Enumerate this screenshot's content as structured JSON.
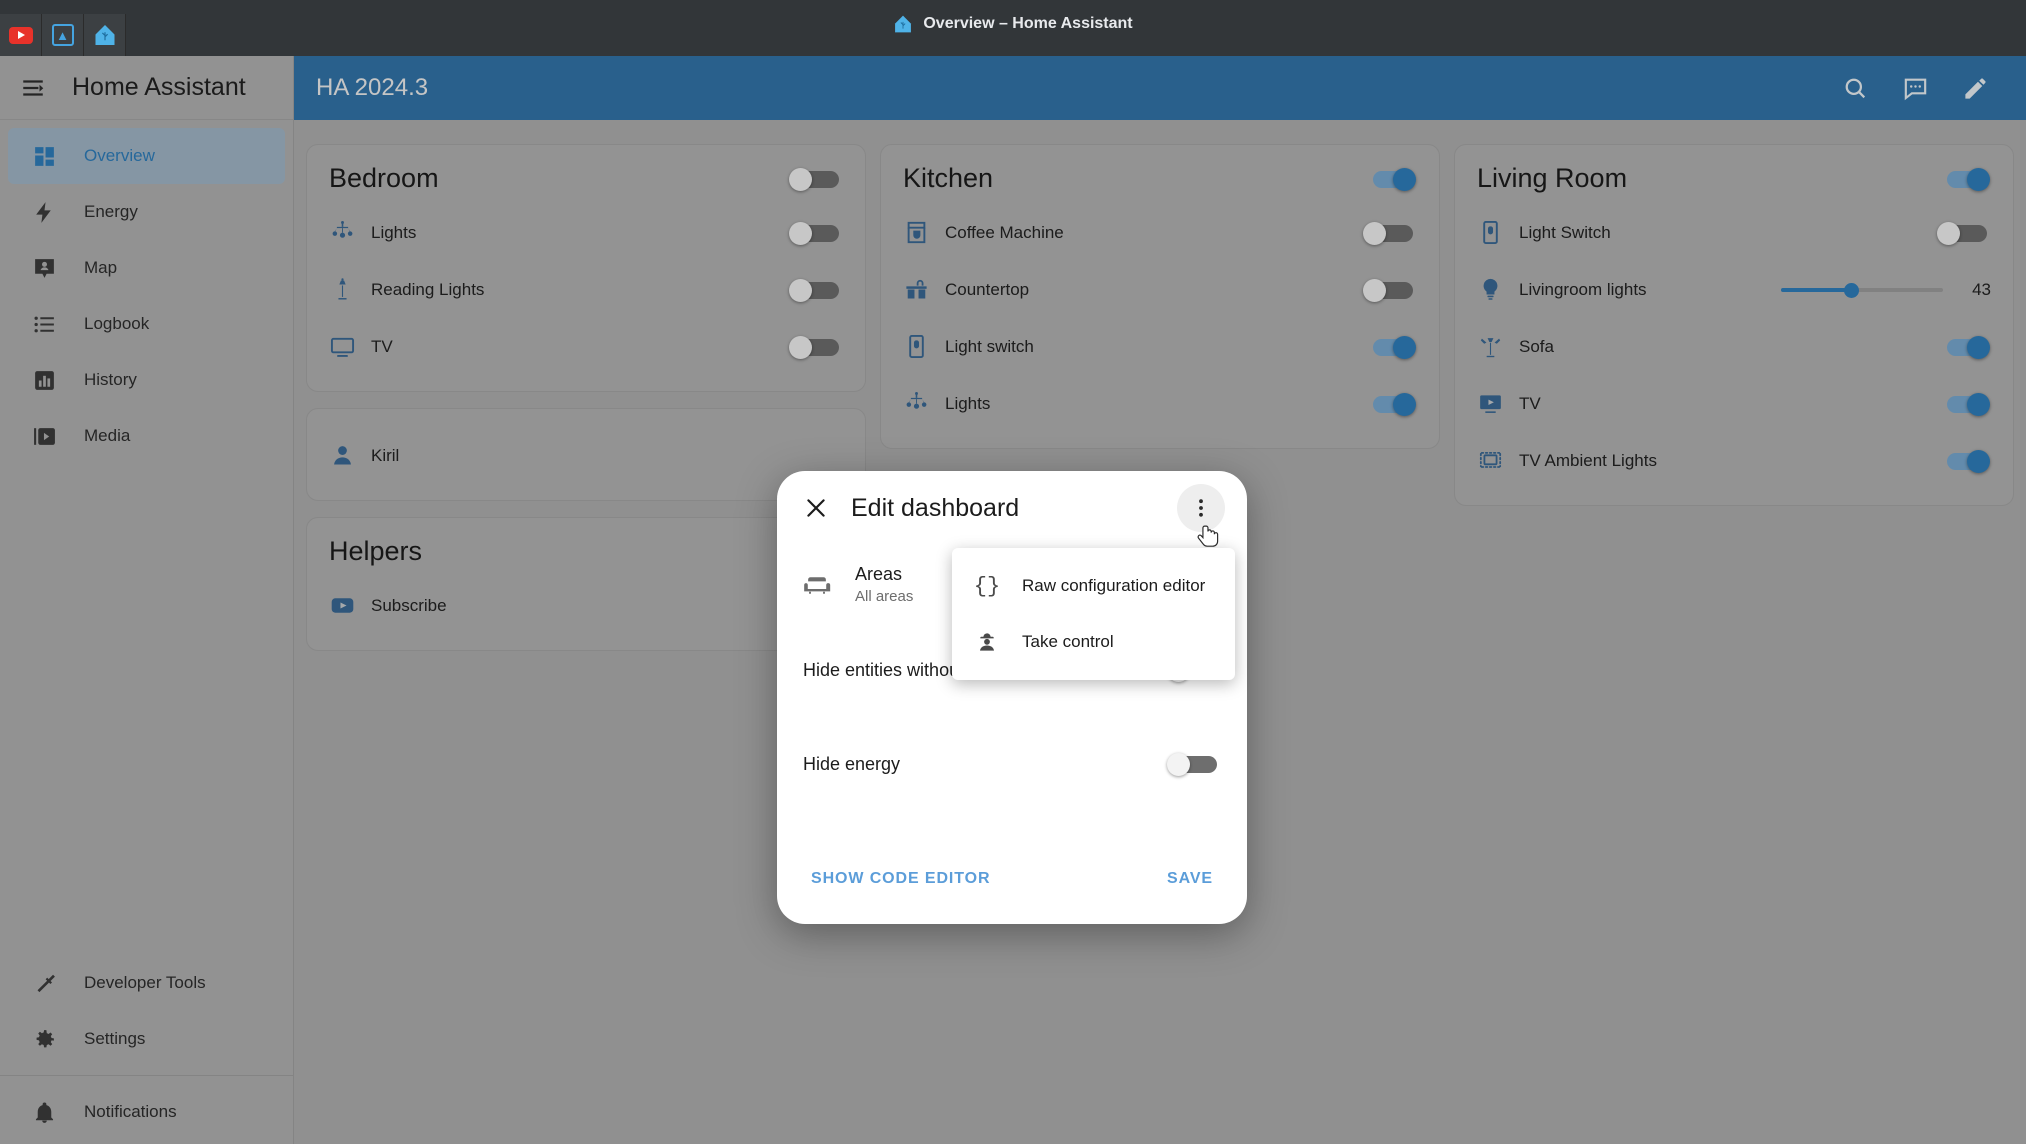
{
  "browser": {
    "window_title": "Overview – Home Assistant",
    "pinned_tabs": [
      {
        "name": "youtube-tab",
        "icon": "youtube-icon"
      },
      {
        "name": "blue-app-tab",
        "icon": "figure-icon"
      },
      {
        "name": "home-assistant-tab",
        "icon": "home-assistant-icon"
      }
    ]
  },
  "sidebar": {
    "title": "Home Assistant",
    "menu_icon": "menu-collapse-icon",
    "items": [
      {
        "label": "Overview",
        "icon": "view-dashboard-icon",
        "active": true
      },
      {
        "label": "Energy",
        "icon": "lightning-bolt-icon",
        "active": false
      },
      {
        "label": "Map",
        "icon": "map-marker-account-icon",
        "active": false
      },
      {
        "label": "Logbook",
        "icon": "format-list-bulleted-icon",
        "active": false
      },
      {
        "label": "History",
        "icon": "chart-box-icon",
        "active": false
      },
      {
        "label": "Media",
        "icon": "play-box-multiple-icon",
        "active": false
      }
    ],
    "bottom_items": [
      {
        "label": "Developer Tools",
        "icon": "hammer-icon"
      },
      {
        "label": "Settings",
        "icon": "gear-icon"
      }
    ],
    "notifications": {
      "label": "Notifications",
      "icon": "bell-icon"
    }
  },
  "topbar": {
    "title": "HA 2024.3",
    "actions": [
      {
        "name": "search-button",
        "icon": "search-icon"
      },
      {
        "name": "assist-button",
        "icon": "chat-assist-icon"
      },
      {
        "name": "edit-dashboard-button",
        "icon": "pencil-icon"
      }
    ]
  },
  "cards": {
    "bedroom": {
      "title": "Bedroom",
      "header_toggle": "off",
      "rows": [
        {
          "label": "Lights",
          "icon": "chandelier-icon",
          "control": "toggle",
          "state": "off"
        },
        {
          "label": "Reading Lights",
          "icon": "floor-lamp-icon",
          "control": "toggle",
          "state": "off"
        },
        {
          "label": "TV",
          "icon": "television-icon",
          "control": "toggle",
          "state": "off"
        }
      ]
    },
    "person": {
      "rows": [
        {
          "label": "Kiril",
          "icon": "account-icon",
          "control": "none"
        }
      ]
    },
    "helpers": {
      "title": "Helpers",
      "rows": [
        {
          "label": "Subscribe",
          "icon": "youtube-icon",
          "control": "none"
        }
      ]
    },
    "kitchen": {
      "title": "Kitchen",
      "header_toggle": "on",
      "rows": [
        {
          "label": "Coffee Machine",
          "icon": "coffee-maker-icon",
          "control": "toggle",
          "state": "off"
        },
        {
          "label": "Countertop",
          "icon": "countertop-icon",
          "control": "toggle",
          "state": "off"
        },
        {
          "label": "Light switch",
          "icon": "light-switch-icon",
          "control": "toggle",
          "state": "on"
        },
        {
          "label": "Lights",
          "icon": "chandelier-icon",
          "control": "toggle",
          "state": "on"
        }
      ]
    },
    "living_room": {
      "title": "Living Room",
      "header_toggle": "on",
      "rows": [
        {
          "label": "Light Switch",
          "icon": "light-switch-icon",
          "control": "toggle",
          "state": "off"
        },
        {
          "label": "Livingroom lights",
          "icon": "lightbulb-icon",
          "control": "slider",
          "value": "43",
          "percent": 43
        },
        {
          "label": "Sofa",
          "icon": "floor-lamp-torchiere-icon",
          "control": "toggle",
          "state": "on"
        },
        {
          "label": "TV",
          "icon": "television-play-icon",
          "control": "toggle",
          "state": "on"
        },
        {
          "label": "TV Ambient Lights",
          "icon": "television-ambient-light-icon",
          "control": "toggle",
          "state": "on"
        }
      ]
    }
  },
  "dialog": {
    "title": "Edit dashboard",
    "close_icon": "close-icon",
    "more_icon": "dots-vertical-icon",
    "areas": {
      "icon": "sofa-icon",
      "title": "Areas",
      "subtitle": "All areas"
    },
    "settings": [
      {
        "label": "Hide entities without area",
        "state": "off"
      },
      {
        "label": "Hide energy",
        "state": "off"
      }
    ],
    "actions": {
      "show_code_editor": "SHOW CODE EDITOR",
      "save": "SAVE"
    }
  },
  "menu": {
    "items": [
      {
        "label": "Raw configuration editor",
        "icon": "code-braces-icon"
      },
      {
        "label": "Take control",
        "icon": "account-hard-hat-icon"
      }
    ]
  },
  "colors": {
    "accent": "#2f7fbd",
    "header": "#3276ab",
    "link": "#5b9dd9",
    "background": "#b0b0b0"
  }
}
